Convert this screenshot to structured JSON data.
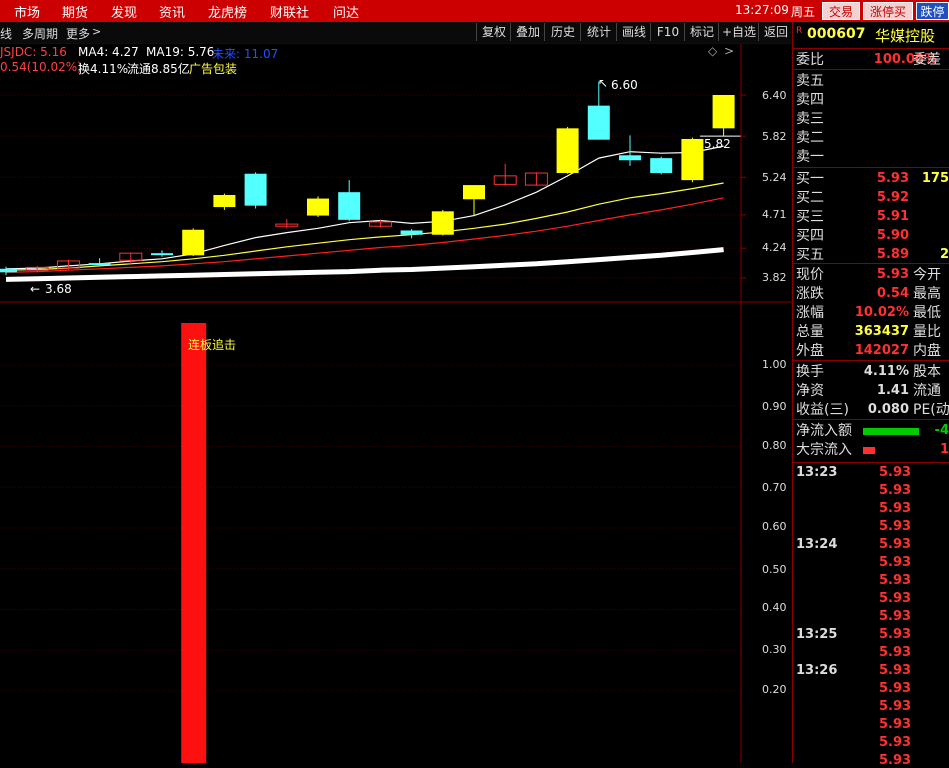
{
  "menu": [
    "市场",
    "期货",
    "发现",
    "资讯",
    "龙虎榜",
    "财联社",
    "问达"
  ],
  "clock": "13:27:09",
  "weekday": "周五",
  "top_buttons": [
    "交易",
    "涨停买",
    "跌停"
  ],
  "toolbar": {
    "left_items": [
      "线",
      "多周期",
      "更多"
    ],
    "buttons": [
      "复权",
      "叠加",
      "历史",
      "统计",
      "画线",
      "F10",
      "标记",
      "+自选",
      "返回"
    ]
  },
  "indicator": {
    "jsjdc": "JSJDC: 5.16",
    "ma4": "MA4: 4.27",
    "ma19": "MA19: 5.76",
    "ma_extra": "未来: 11.07",
    "change_line": "0.54(10.02%)",
    "turnover": "换4.11%",
    "float": "流通8.85亿",
    "tag": "广告包装"
  },
  "annotations": {
    "high": "6.60",
    "low": "3.68",
    "last_price": "5.82",
    "signal_label": "连板追击"
  },
  "price_axis": [
    "6.40",
    "5.82",
    "5.24",
    "4.71",
    "4.24",
    "3.82"
  ],
  "volume_axis": [
    "1.00",
    "0.90",
    "0.80",
    "0.70",
    "0.60",
    "0.50",
    "0.40",
    "0.30",
    "0.20"
  ],
  "chart_data": {
    "type": "candlestick",
    "candles": [
      {
        "o": 3.9,
        "c": 3.95,
        "h": 3.98,
        "l": 3.86,
        "color": "cyan"
      },
      {
        "o": 3.93,
        "c": 3.97,
        "h": 3.99,
        "l": 3.9,
        "color": "red"
      },
      {
        "o": 3.96,
        "c": 4.06,
        "h": 4.08,
        "l": 3.94,
        "color": "red"
      },
      {
        "o": 4.01,
        "c": 4.03,
        "h": 4.1,
        "l": 3.99,
        "color": "cyan"
      },
      {
        "o": 4.07,
        "c": 4.17,
        "h": 4.18,
        "l": 4.02,
        "color": "red"
      },
      {
        "o": 4.17,
        "c": 4.15,
        "h": 4.21,
        "l": 4.12,
        "color": "cyan"
      },
      {
        "o": 4.14,
        "c": 4.5,
        "h": 4.52,
        "l": 4.13,
        "color": "yellow"
      },
      {
        "o": 4.82,
        "c": 4.99,
        "h": 5.01,
        "l": 4.78,
        "color": "yellow"
      },
      {
        "o": 5.29,
        "c": 4.84,
        "h": 5.31,
        "l": 4.8,
        "color": "cyan"
      },
      {
        "o": 4.58,
        "c": 4.55,
        "h": 4.65,
        "l": 4.52,
        "color": "red"
      },
      {
        "o": 4.7,
        "c": 4.94,
        "h": 4.97,
        "l": 4.68,
        "color": "yellow"
      },
      {
        "o": 5.03,
        "c": 4.64,
        "h": 5.2,
        "l": 4.62,
        "color": "cyan"
      },
      {
        "o": 4.55,
        "c": 4.61,
        "h": 4.64,
        "l": 4.53,
        "color": "red"
      },
      {
        "o": 4.49,
        "c": 4.43,
        "h": 4.51,
        "l": 4.38,
        "color": "cyan"
      },
      {
        "o": 4.43,
        "c": 4.76,
        "h": 4.78,
        "l": 4.42,
        "color": "yellow"
      },
      {
        "o": 4.93,
        "c": 5.13,
        "h": 4.93,
        "l": 4.7,
        "color": "yellow"
      },
      {
        "o": 5.14,
        "c": 5.26,
        "h": 5.43,
        "l": 5.12,
        "color": "red"
      },
      {
        "o": 5.13,
        "c": 5.3,
        "h": 5.31,
        "l": 5.12,
        "color": "red"
      },
      {
        "o": 5.3,
        "c": 5.93,
        "h": 5.95,
        "l": 5.29,
        "color": "yellow"
      },
      {
        "o": 6.25,
        "c": 5.77,
        "h": 6.59,
        "l": 5.77,
        "color": "cyan"
      },
      {
        "o": 5.55,
        "c": 5.48,
        "h": 5.83,
        "l": 5.4,
        "color": "cyan"
      },
      {
        "o": 5.51,
        "c": 5.3,
        "h": 5.53,
        "l": 5.28,
        "color": "cyan"
      },
      {
        "o": 5.2,
        "c": 5.78,
        "h": 5.8,
        "l": 5.17,
        "color": "yellow"
      },
      {
        "o": 6.4,
        "c": 5.93,
        "h": 6.4,
        "l": 5.82,
        "color": "yellow"
      }
    ],
    "ma_white": [
      3.95,
      3.96,
      3.99,
      4.02,
      4.06,
      4.09,
      4.16,
      4.28,
      4.39,
      4.46,
      4.52,
      4.6,
      4.63,
      4.59,
      4.62,
      4.7,
      4.85,
      5.03,
      5.26,
      5.51,
      5.6,
      5.58,
      5.59,
      5.68
    ],
    "ma_yellow": [
      3.93,
      3.94,
      3.96,
      3.99,
      4.02,
      4.05,
      4.09,
      4.14,
      4.2,
      4.26,
      4.31,
      4.36,
      4.4,
      4.43,
      4.47,
      4.52,
      4.58,
      4.66,
      4.75,
      4.86,
      4.95,
      5.01,
      5.08,
      5.16
    ],
    "ma_red": [
      3.9,
      3.91,
      3.93,
      3.95,
      3.97,
      3.99,
      4.02,
      4.05,
      4.09,
      4.13,
      4.17,
      4.21,
      4.25,
      4.28,
      4.32,
      4.37,
      4.42,
      4.48,
      4.55,
      4.63,
      4.71,
      4.78,
      4.86,
      4.95
    ],
    "ma_thick": [
      3.8,
      3.81,
      3.82,
      3.83,
      3.84,
      3.85,
      3.86,
      3.87,
      3.88,
      3.89,
      3.9,
      3.91,
      3.93,
      3.94,
      3.96,
      3.98,
      4.0,
      4.02,
      4.05,
      4.08,
      4.11,
      4.14,
      4.18,
      4.22
    ],
    "volume_bar": {
      "index": 6,
      "value": 1.0
    },
    "price_range": [
      3.7,
      6.7
    ],
    "volume_range": [
      0.12,
      1.1
    ]
  },
  "quote": {
    "code": "000607",
    "name": "华媒控股",
    "r_badge": "R",
    "weibi_label": "委比",
    "weibi_value": "100.00%",
    "weicha_label": "委差",
    "sells": [
      "卖五",
      "卖四",
      "卖三",
      "卖二",
      "卖一"
    ],
    "buys": [
      {
        "label": "买一",
        "price": "5.93",
        "vol": "175"
      },
      {
        "label": "买二",
        "price": "5.92",
        "vol": ""
      },
      {
        "label": "买三",
        "price": "5.91",
        "vol": ""
      },
      {
        "label": "买四",
        "price": "5.90",
        "vol": ""
      },
      {
        "label": "买五",
        "price": "5.89",
        "vol": "2"
      }
    ],
    "stats": [
      {
        "l": "现价",
        "v": "5.93",
        "r": "今开",
        "vc": "#ff3030"
      },
      {
        "l": "涨跌",
        "v": "0.54",
        "r": "最高",
        "vc": "#ff3030"
      },
      {
        "l": "涨幅",
        "v": "10.02%",
        "r": "最低",
        "vc": "#ff3030"
      },
      {
        "l": "总量",
        "v": "363437",
        "r": "量比",
        "vc": "#ffff40"
      },
      {
        "l": "外盘",
        "v": "142027",
        "r": "内盘",
        "vc": "#ff3030"
      }
    ],
    "stats2": [
      {
        "l": "换手",
        "v": "4.11%",
        "r": "股本",
        "vc": "#dddddd"
      },
      {
        "l": "净资",
        "v": "1.41",
        "r": "流通",
        "vc": "#dddddd"
      },
      {
        "l": "收益(三)",
        "v": "0.080",
        "r": "PE(动)",
        "vc": "#dddddd"
      }
    ],
    "flow": [
      {
        "l": "净流入额",
        "v": "-4",
        "bar": "#00cc00"
      },
      {
        "l": "大宗流入",
        "v": "1",
        "bar": "#ff3030"
      }
    ]
  },
  "ticks": [
    {
      "time": "13:23",
      "prices": [
        "5.93",
        "5.93",
        "5.93",
        "5.93"
      ]
    },
    {
      "time": "13:24",
      "prices": [
        "5.93",
        "5.93",
        "5.93",
        "5.93",
        "5.93"
      ]
    },
    {
      "time": "13:25",
      "prices": [
        "5.93",
        "5.93"
      ]
    },
    {
      "time": "13:26",
      "prices": [
        "5.93",
        "5.93",
        "5.93",
        "5.93",
        "5.93",
        "5.93"
      ]
    }
  ]
}
